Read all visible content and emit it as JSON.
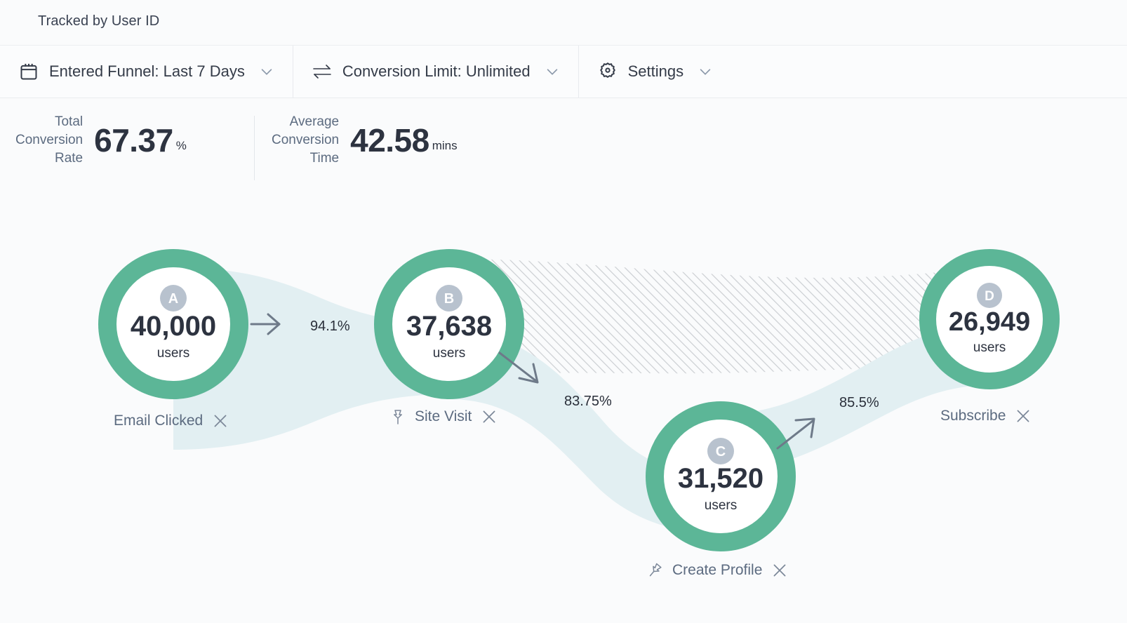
{
  "header": {
    "tracked_by": "Tracked by User ID"
  },
  "toolbar": {
    "items": [
      {
        "icon": "calendar-icon",
        "label": "Entered Funnel: Last 7 Days",
        "chevron": "chevron-down-icon"
      },
      {
        "icon": "conversion-limit-icon",
        "label": "Conversion Limit: Unlimited",
        "chevron": "chevron-down-icon"
      },
      {
        "icon": "gear-icon",
        "label": "Settings",
        "chevron": "chevron-down-icon"
      }
    ]
  },
  "kpis": [
    {
      "label": "Total\nConversion\nRate",
      "value": "67.37",
      "unit": "%"
    },
    {
      "label": "Average\nConversion\nTime",
      "value": "42.58",
      "unit": "mins"
    }
  ],
  "colors": {
    "ring_green": "#5CB697",
    "flow_blue": "#E2EFF2",
    "badge_gray": "#B8C2CE",
    "hatch_gray": "#B9BDC2",
    "arrow_gray": "#6E7A89",
    "text_dark": "#2D3340",
    "text_muted": "#5C6B80",
    "background": "#FAFBFC"
  },
  "chart_data": {
    "type": "funnel",
    "title": "Tracked by User ID",
    "total_conversion_rate": 67.37,
    "total_conversion_rate_unit": "%",
    "average_conversion_time": 42.58,
    "average_conversion_time_unit": "mins",
    "steps": [
      {
        "badge": "A",
        "value": "40,000",
        "count": 40000,
        "unit": "users",
        "label": "Email Clicked",
        "pinned": null,
        "removable": true
      },
      {
        "badge": "B",
        "value": "37,638",
        "count": 37638,
        "unit": "users",
        "label": "Site Visit",
        "pinned": true,
        "removable": true
      },
      {
        "badge": "C",
        "value": "31,520",
        "count": 31520,
        "unit": "users",
        "label": "Create Profile",
        "pinned": false,
        "removable": true
      },
      {
        "badge": "D",
        "value": "26,949",
        "count": 26949,
        "unit": "users",
        "label": "Subscribe",
        "pinned": null,
        "removable": true
      }
    ],
    "transitions": [
      {
        "from": "A",
        "to": "B",
        "label": "94.1%",
        "rate": 94.1
      },
      {
        "from": "B",
        "to": "C",
        "label": "83.75%",
        "rate": 83.75
      },
      {
        "from": "C",
        "to": "D",
        "label": "85.5%",
        "rate": 85.5
      }
    ],
    "skipped_flow": {
      "from": "B",
      "to": "D",
      "style": "diagonal-hatch"
    }
  }
}
